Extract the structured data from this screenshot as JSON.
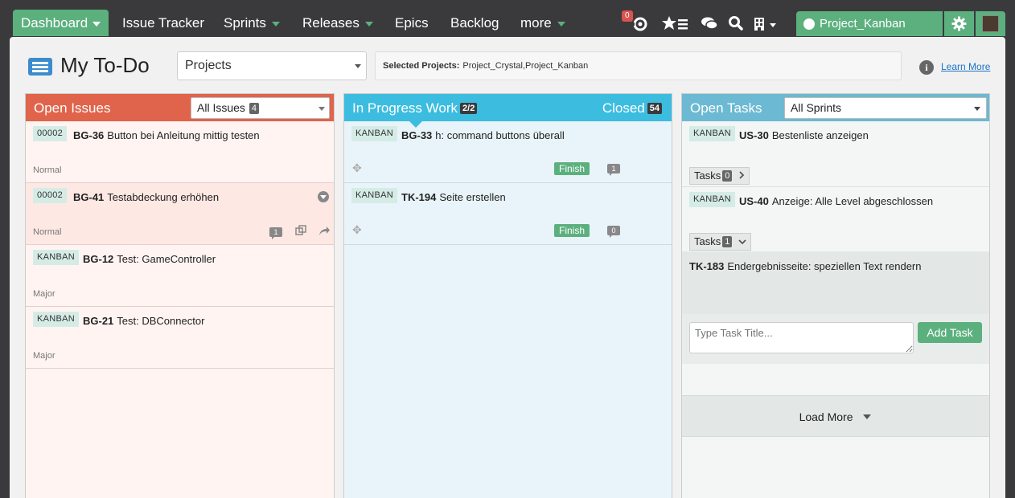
{
  "nav": {
    "items": [
      {
        "label": "Dashboard"
      },
      {
        "label": "Issue Tracker"
      },
      {
        "label": "Sprints"
      },
      {
        "label": "Releases"
      },
      {
        "label": "Epics"
      },
      {
        "label": "Backlog"
      },
      {
        "label": "more"
      }
    ],
    "notification_count": "0",
    "project": "Project_Kanban"
  },
  "header": {
    "title": "My To-Do",
    "projects_dropdown": "Projects",
    "selected_label": "Selected Projects:",
    "selected_value": "Project_Crystal,Project_Kanban",
    "learn_more": "Learn More",
    "info": "i"
  },
  "open_issues": {
    "title": "Open Issues",
    "filter": "All Issues",
    "filter_count": "4",
    "cards": [
      {
        "tag": "00002",
        "key": "BG-36",
        "summary": "Button bei Anleitung mittig testen",
        "priority": "Normal"
      },
      {
        "tag": "00002",
        "key": "BG-41",
        "summary": "Testabdeckung erhöhen",
        "priority": "Normal",
        "comments": "1"
      },
      {
        "tag": "KANBAN",
        "key": "BG-12",
        "summary": "Test: GameController",
        "priority": "Major"
      },
      {
        "tag": "KANBAN",
        "key": "BG-21",
        "summary": "Test: DBConnector",
        "priority": "Major"
      }
    ]
  },
  "in_progress": {
    "title": "In Progress Work",
    "count": "2/2",
    "closed_label": "Closed",
    "closed_count": "54",
    "finish_label": "Finish",
    "cards": [
      {
        "tag": "KANBAN",
        "key": "BG-33",
        "summary": "h: command buttons überall",
        "comments": "1"
      },
      {
        "tag": "KANBAN",
        "key": "TK-194",
        "summary": "Seite erstellen",
        "comments": "0"
      }
    ]
  },
  "open_tasks": {
    "title": "Open Tasks",
    "filter": "All Sprints",
    "tasks_label": "Tasks",
    "cards": [
      {
        "tag": "KANBAN",
        "key": "US-30",
        "summary": "Bestenliste anzeigen",
        "task_count": "0"
      },
      {
        "tag": "KANBAN",
        "key": "US-40",
        "summary": "Anzeige: Alle Level abgeschlossen",
        "task_count": "1"
      }
    ],
    "task_item": {
      "key": "TK-183",
      "summary": "Endergebnisseite: speziellen Text rendern"
    },
    "input_placeholder": "Type Task Title...",
    "add_task": "Add Task",
    "load_more": "Load More"
  }
}
